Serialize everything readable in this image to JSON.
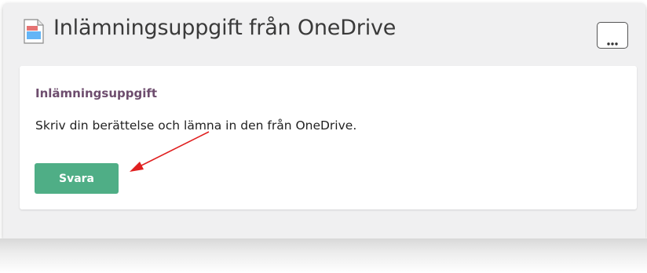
{
  "header": {
    "title": "Inlämningsuppgift från OneDrive",
    "more_icon": "ellipsis-icon",
    "doc_icon": "document-icon"
  },
  "assignment": {
    "heading": "Inlämningsuppgift",
    "description": "Skriv din berättelse och lämna in den från OneDrive.",
    "reply_label": "Svara"
  },
  "annotation": {
    "type": "arrow",
    "color": "#e02020"
  },
  "colors": {
    "heading": "#6e4d6e",
    "button": "#4fae86",
    "panel": "#f0f0f1"
  }
}
